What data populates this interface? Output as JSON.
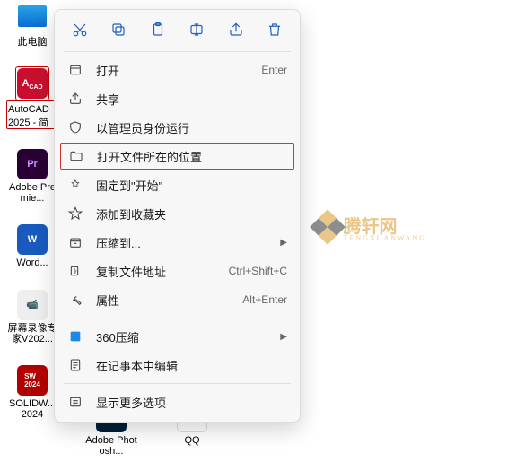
{
  "desktop": {
    "items": [
      {
        "label": "此电脑"
      },
      {
        "label": "AutoCAD 2025 - 简"
      },
      {
        "label": "Adobe Premie..."
      },
      {
        "label": "Word..."
      },
      {
        "label": "屏幕录像专家V202..."
      },
      {
        "label": "SOLIDW... 2024"
      }
    ],
    "bottom": [
      {
        "label": "Adobe Photosh..."
      },
      {
        "label": "QQ"
      }
    ]
  },
  "toolbar": {
    "cut": "剪切",
    "copy": "复制",
    "paste": "粘贴",
    "rename": "重命名",
    "share": "共享",
    "delete": "删除"
  },
  "menu": {
    "open": {
      "label": "打开",
      "accel": "Enter"
    },
    "share": {
      "label": "共享"
    },
    "runas": {
      "label": "以管理员身份运行"
    },
    "openloc": {
      "label": "打开文件所在的位置"
    },
    "pin": {
      "label": "固定到\"开始\""
    },
    "fav": {
      "label": "添加到收藏夹"
    },
    "compress": {
      "label": "压缩到..."
    },
    "copypath": {
      "label": "复制文件地址",
      "accel": "Ctrl+Shift+C"
    },
    "props": {
      "label": "属性",
      "accel": "Alt+Enter"
    },
    "z360": {
      "label": "360压缩"
    },
    "notepad": {
      "label": "在记事本中编辑"
    },
    "more": {
      "label": "显示更多选项"
    }
  },
  "watermark": {
    "name": "腾轩网",
    "sub": "TENGXUANWANG"
  }
}
